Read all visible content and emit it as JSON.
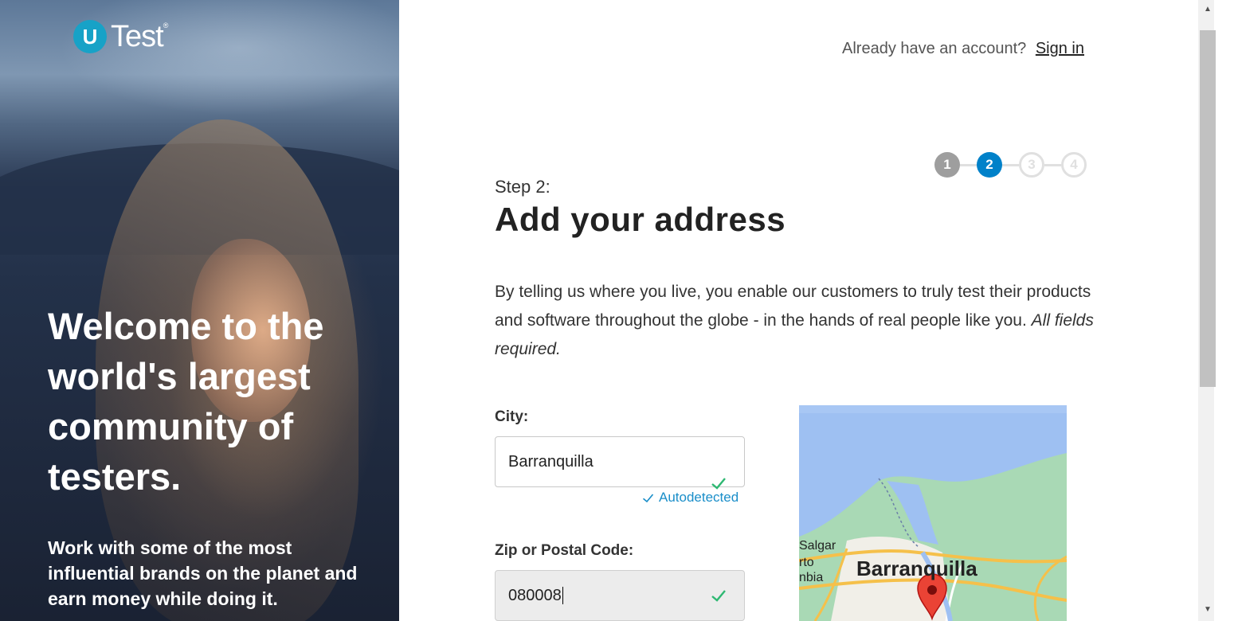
{
  "brand": {
    "badge": "U",
    "name": "Test",
    "reg": "®"
  },
  "hero": {
    "title": "Welcome to the world's largest community of testers.",
    "subtitle": "Work with some of the most influential brands on the planet and earn money while doing it."
  },
  "header": {
    "account_prompt": "Already have an account?",
    "signin_label": "Sign in"
  },
  "stepper": {
    "steps": [
      "1",
      "2",
      "3",
      "4"
    ],
    "current": 2
  },
  "form": {
    "step_label": "Step 2:",
    "title": "Add your address",
    "intro": "By telling us where you live, you enable our customers to truly test their products and software throughout the globe - in the hands of real people like you.",
    "intro_required": "All fields required.",
    "city_label": "City:",
    "city_value": "Barranquilla",
    "autodetected_label": "Autodetected",
    "zip_label": "Zip or Postal Code:",
    "zip_value": "080008"
  },
  "map": {
    "city_label": "Barranquilla",
    "labels": [
      "Salgar",
      "rto",
      "nbia"
    ]
  },
  "colors": {
    "accent": "#0081c9",
    "check": "#2eb872",
    "brand_badge": "#17a2c7"
  }
}
